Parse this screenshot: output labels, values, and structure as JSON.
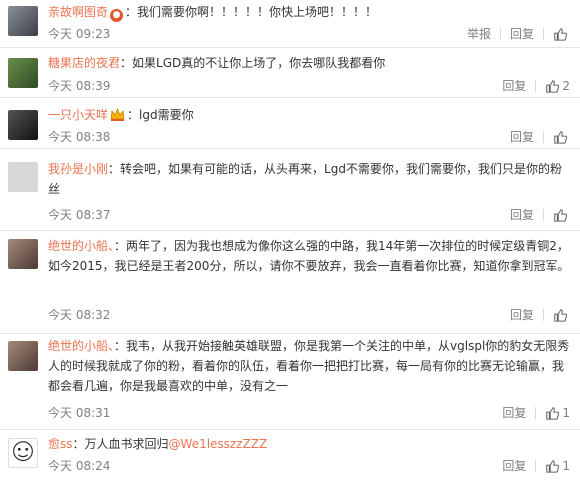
{
  "actions": {
    "report_label": "举报",
    "reply_label": "回复"
  },
  "comments": [
    {
      "user": "亲故啊图奇",
      "text": "：我们需要你啊！！！！！你快上场吧！！！！",
      "time": "今天 09:23",
      "like_count": ""
    },
    {
      "user": "糖果店的夜君",
      "text": "：如果LGD真的不让你上场了，你去哪队我都看你",
      "time": "今天 08:39",
      "like_count": "2"
    },
    {
      "user": "一只小天咩",
      "text": "：lgd需要你",
      "time": "今天 08:38",
      "like_count": ""
    },
    {
      "user": "我孙是小刚",
      "text": "：转会吧，如果有可能的话，从头再来，Lgd不需要你，我们需要你，我们只是你的粉丝",
      "time": "今天 08:37",
      "like_count": ""
    },
    {
      "user": "绝世的小船、",
      "text": "：两年了，因为我也想成为像你这么强的中路，我14年第一次排位的时候定级青铜2，如今2015，我已经是王者200分，所以，请你不要放弃，我会一直看着你比赛，知道你拿到冠军。",
      "time": "今天 08:32",
      "like_count": ""
    },
    {
      "user": "绝世的小船、",
      "text": "：我韦，从我开始接触英雄联盟，你是我第一个关注的中单，从vglspl你的豹女无限秀人的时候我就成了你的粉，看着你的队伍，看着你一把把打比赛，每一局有你的比赛无论输赢，我都会看几遍，你是我最喜欢的中单，没有之一",
      "time": "今天 08:31",
      "like_count": "1"
    },
    {
      "user": "愈ss",
      "text": "：万人血书求回归",
      "mention": "@We1lesszzZZZ",
      "time": "今天 08:24",
      "like_count": "1"
    }
  ],
  "icons": {
    "badge": "red-circle-badge-icon",
    "crown": "crown-badge-icon",
    "like": "thumbs-up-icon"
  }
}
